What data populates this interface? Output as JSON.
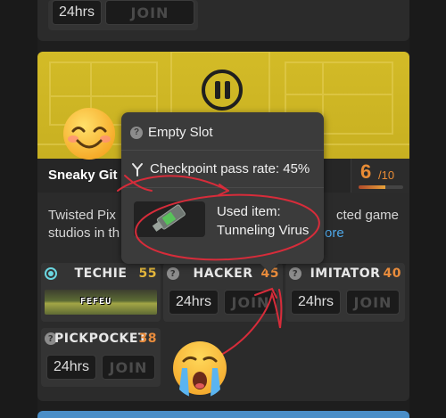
{
  "top_card": {
    "time_label": "24hrs",
    "join_label": "JOIN"
  },
  "card": {
    "title": "Sneaky Git C",
    "score": "6",
    "score_max": "/10",
    "score_fraction": 0.6,
    "description_line1": "Twisted  Pix",
    "description_line1_end": "cted  game",
    "description_line2": "studios in th",
    "more_label": "ore"
  },
  "tooltip": {
    "slot_label": "Empty Slot",
    "checkpoint_label": "Checkpoint pass rate: 45%",
    "used_item_label": "Used item:",
    "used_item_name": "Tunneling Virus"
  },
  "roles": [
    {
      "name": "TECHIE",
      "count": "55",
      "player": "FEFEU"
    },
    {
      "name": "HACKER",
      "count": "45",
      "time_label": "24hrs",
      "join_label": "JOIN"
    },
    {
      "name": "IMITATOR",
      "count": "40",
      "time_label": "24hrs",
      "join_label": "JOIN"
    },
    {
      "name": "PICKPOCKET",
      "count": "38",
      "time_label": "24hrs",
      "join_label": "JOIN"
    }
  ],
  "colors": {
    "accent_orange": "#e98c35",
    "banner_yellow": "#d3bb27",
    "link_blue": "#4ea7e7",
    "annotation_red": "#d72c3a"
  }
}
